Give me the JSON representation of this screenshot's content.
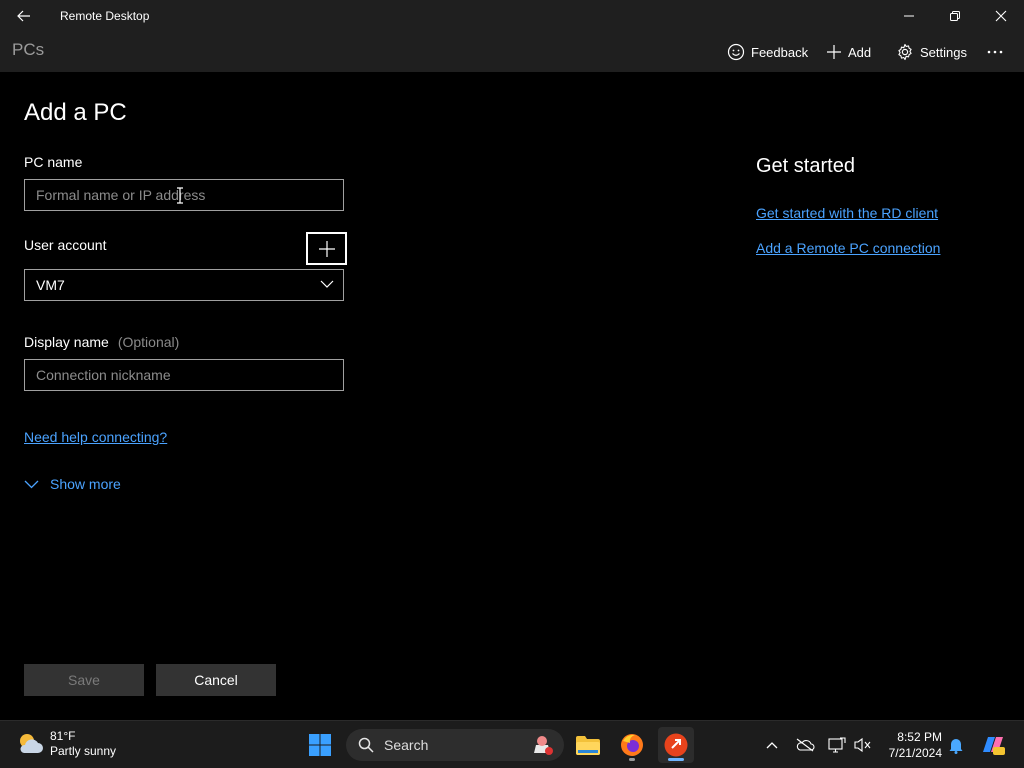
{
  "app": {
    "title": "Remote Desktop"
  },
  "commandbar": {
    "section_label": "PCs",
    "feedback_label": "Feedback",
    "add_label": "Add",
    "settings_label": "Settings"
  },
  "form": {
    "title": "Add a PC",
    "pc_name": {
      "label": "PC name",
      "placeholder": "Formal name or IP address",
      "value": ""
    },
    "user_account": {
      "label": "User account",
      "selected": "VM7"
    },
    "display_name": {
      "label": "Display name",
      "hint": "(Optional)",
      "placeholder": "Connection nickname",
      "value": ""
    },
    "help_link": "Need help connecting?",
    "show_more": "Show more",
    "save_label": "Save",
    "cancel_label": "Cancel"
  },
  "sidebar": {
    "title": "Get started",
    "links": [
      "Get started with the RD client",
      "Add a Remote PC connection"
    ]
  },
  "taskbar": {
    "weather": {
      "temp": "81°F",
      "condition": "Partly sunny"
    },
    "search_label": "Search",
    "clock": {
      "time": "8:52 PM",
      "date": "7/21/2024"
    }
  },
  "colors": {
    "accent_link": "#4ba3ff",
    "background": "#000000",
    "chrome": "#1f1f1f"
  }
}
